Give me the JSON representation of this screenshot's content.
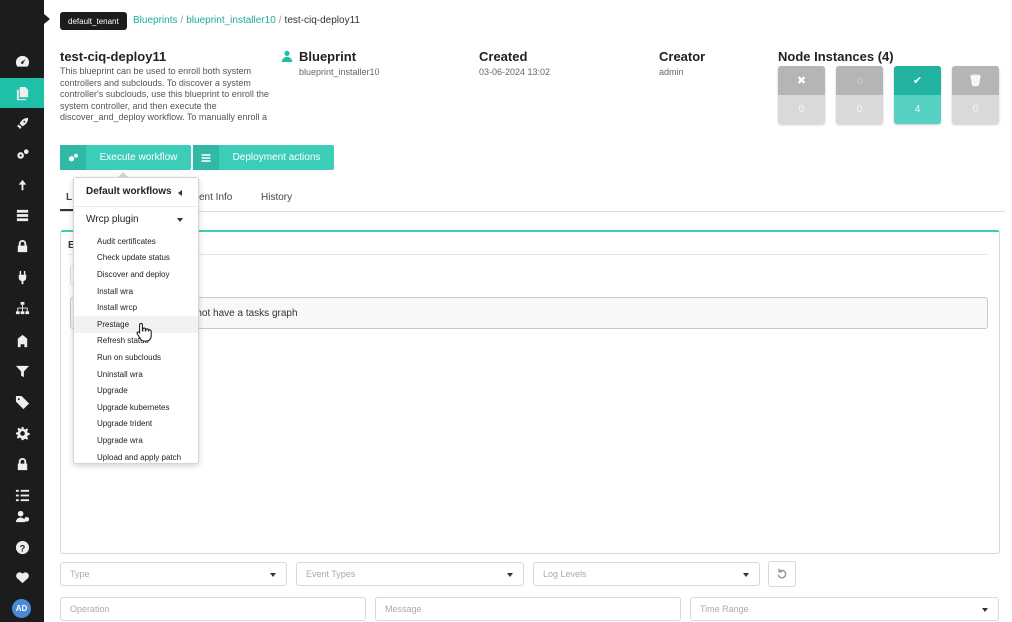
{
  "tenant": "default_tenant",
  "breadcrumb": {
    "blueprints": "Blueprints",
    "sep": "/",
    "blueprint": "blueprint_installer10",
    "current": "test-ciq-deploy11"
  },
  "sidebar": {
    "items": [
      "dashboard-icon",
      "deployments-icon",
      "rocket-icon",
      "cogs-icon",
      "upload-icon",
      "server-icon",
      "lock-icon",
      "plug-icon",
      "sitemap-icon",
      "building-icon",
      "filter-icon",
      "tags-icon",
      "settings-icon",
      "lock-icon",
      "tasks-icon",
      "user-cog-icon",
      "help-icon",
      "heartbeat-icon"
    ],
    "avatar": "AD"
  },
  "deployment": {
    "name": "test-ciq-deploy11",
    "description": "This blueprint can be used to enroll both system controllers and subclouds. To discover a system controller's subclouds, use this blueprint to enroll the system controller, and then execute the discover_and_deploy workflow. To manually enroll a"
  },
  "blueprint": {
    "label": "Blueprint",
    "value": "blueprint_installer10"
  },
  "created": {
    "label": "Created",
    "value": "03-06-2024 13:02"
  },
  "creator": {
    "label": "Creator",
    "value": "admin"
  },
  "node_instances": {
    "title": "Node Instances (4)",
    "boxes": [
      {
        "icon": "close-icon",
        "glyph": "✖",
        "count": "0",
        "color": "#b5b5b5"
      },
      {
        "icon": "spinner-icon",
        "glyph": "◌",
        "count": "0",
        "color": "#b5b5b5"
      },
      {
        "icon": "check-icon",
        "glyph": "✔",
        "count": "4",
        "color": "#21b3a0"
      },
      {
        "icon": "trash-icon",
        "glyph": "🗑",
        "count": "0",
        "color": "#b5b5b5"
      }
    ]
  },
  "actions": {
    "execute": "Execute workflow",
    "deployment": "Deployment actions"
  },
  "tabs": {
    "first": "L",
    "second": "ent Info",
    "history": "History"
  },
  "panel": {
    "head": "E",
    "message": "es not have a tasks graph"
  },
  "filters": {
    "type": "Type",
    "event_types": "Event Types",
    "log_levels": "Log Levels",
    "operation": "Operation",
    "message": "Message",
    "time_range": "Time Range"
  },
  "menu": {
    "default_workflows": "Default workflows",
    "plugin": "Wrcp plugin",
    "items": [
      "Audit certificates",
      "Check update status",
      "Discover and deploy",
      "Install wra",
      "Install wrcp",
      "Prestage",
      "Refresh status",
      "Run on subclouds",
      "Uninstall wra",
      "Upgrade",
      "Upgrade kubernetes",
      "Upgrade trident",
      "Upgrade wra",
      "Upload and apply patch"
    ],
    "hovered": "Prestage"
  },
  "colors": {
    "accent": "#3ccdb9",
    "sidebar": "#1b1c1d"
  }
}
